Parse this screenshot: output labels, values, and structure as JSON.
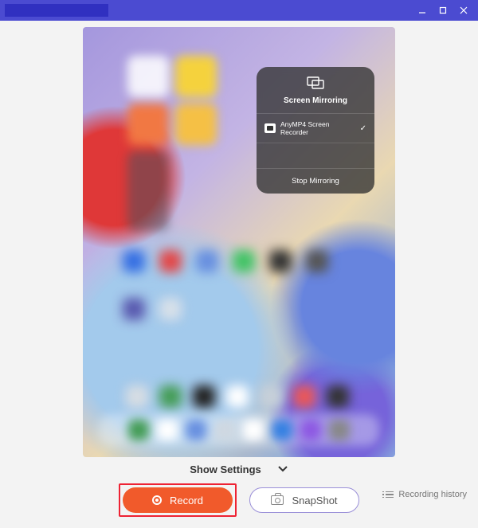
{
  "titlebar": {
    "app_title": ""
  },
  "mirror": {
    "title": "Screen Mirroring",
    "item_label": "AnyMP4 Screen Recorder",
    "stop_label": "Stop Mirroring"
  },
  "settings": {
    "toggle_label": "Show Settings"
  },
  "buttons": {
    "record": "Record",
    "snapshot": "SnapShot"
  },
  "history": {
    "label": "Recording history"
  }
}
